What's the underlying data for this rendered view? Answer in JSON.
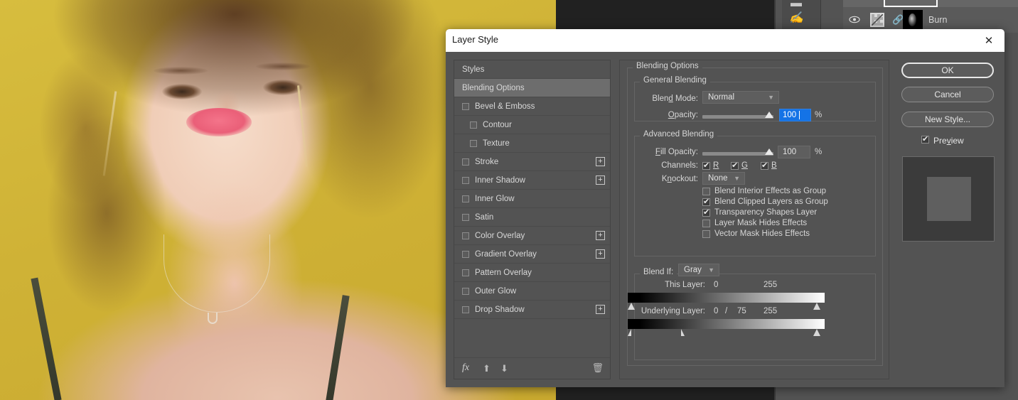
{
  "app": {
    "background_layer_name": "Burn",
    "photo_backdrop_color": "#cfb236"
  },
  "dialog": {
    "title": "Layer Style",
    "close_icon": "close-icon"
  },
  "styles_list": {
    "header": "Styles",
    "active": "Blending Options",
    "items": [
      {
        "label": "Bevel & Emboss",
        "checked": false,
        "indent": false,
        "plus": false
      },
      {
        "label": "Contour",
        "checked": false,
        "indent": true,
        "plus": false
      },
      {
        "label": "Texture",
        "checked": false,
        "indent": true,
        "plus": false
      },
      {
        "label": "Stroke",
        "checked": false,
        "indent": false,
        "plus": true
      },
      {
        "label": "Inner Shadow",
        "checked": false,
        "indent": false,
        "plus": true
      },
      {
        "label": "Inner Glow",
        "checked": false,
        "indent": false,
        "plus": false
      },
      {
        "label": "Satin",
        "checked": false,
        "indent": false,
        "plus": false
      },
      {
        "label": "Color Overlay",
        "checked": false,
        "indent": false,
        "plus": true
      },
      {
        "label": "Gradient Overlay",
        "checked": false,
        "indent": false,
        "plus": true
      },
      {
        "label": "Pattern Overlay",
        "checked": false,
        "indent": false,
        "plus": false
      },
      {
        "label": "Outer Glow",
        "checked": false,
        "indent": false,
        "plus": false
      },
      {
        "label": "Drop Shadow",
        "checked": false,
        "indent": false,
        "plus": true
      }
    ],
    "footer": {
      "fx_icon": "fx-icon",
      "move_up_icon": "arrow-up-icon",
      "move_down_icon": "arrow-down-icon",
      "delete_icon": "trash-icon"
    }
  },
  "blending_options": {
    "group_label": "Blending Options",
    "general": {
      "group_label": "General Blending",
      "blend_mode_label": "Blend Mode:",
      "blend_mode_value": "Normal",
      "opacity_label": "Opacity:",
      "opacity_value": "100",
      "opacity_unit": "%",
      "opacity_slider_pct": 100,
      "opacity_focused": true
    },
    "advanced": {
      "group_label": "Advanced Blending",
      "fill_opacity_label": "Fill Opacity:",
      "fill_opacity_value": "100",
      "fill_opacity_unit": "%",
      "fill_opacity_slider_pct": 100,
      "channels_label": "Channels:",
      "channels": [
        {
          "label": "R",
          "checked": true
        },
        {
          "label": "G",
          "checked": true
        },
        {
          "label": "B",
          "checked": true
        }
      ],
      "knockout_label": "Knockout:",
      "knockout_value": "None",
      "checkboxes": [
        {
          "label": "Blend Interior Effects as Group",
          "checked": false
        },
        {
          "label": "Blend Clipped Layers as Group",
          "checked": true
        },
        {
          "label": "Transparency Shapes Layer",
          "checked": true
        },
        {
          "label": "Layer Mask Hides Effects",
          "checked": false
        },
        {
          "label": "Vector Mask Hides Effects",
          "checked": false
        }
      ]
    },
    "blend_if": {
      "label": "Blend If:",
      "channel_value": "Gray",
      "this_layer": {
        "label": "This Layer:",
        "low": "0",
        "high": "255",
        "low_pos_pct": 0,
        "high_pos_pct": 100
      },
      "underlying_layer": {
        "label": "Underlying Layer:",
        "low": "0",
        "low_split": "75",
        "high": "255",
        "low_pos_pct": 0,
        "split_pos_pct": 29,
        "high_pos_pct": 100
      }
    }
  },
  "actions": {
    "ok": "OK",
    "cancel": "Cancel",
    "new_style": "New Style...",
    "preview_label": "Preview",
    "preview_checked": true
  }
}
